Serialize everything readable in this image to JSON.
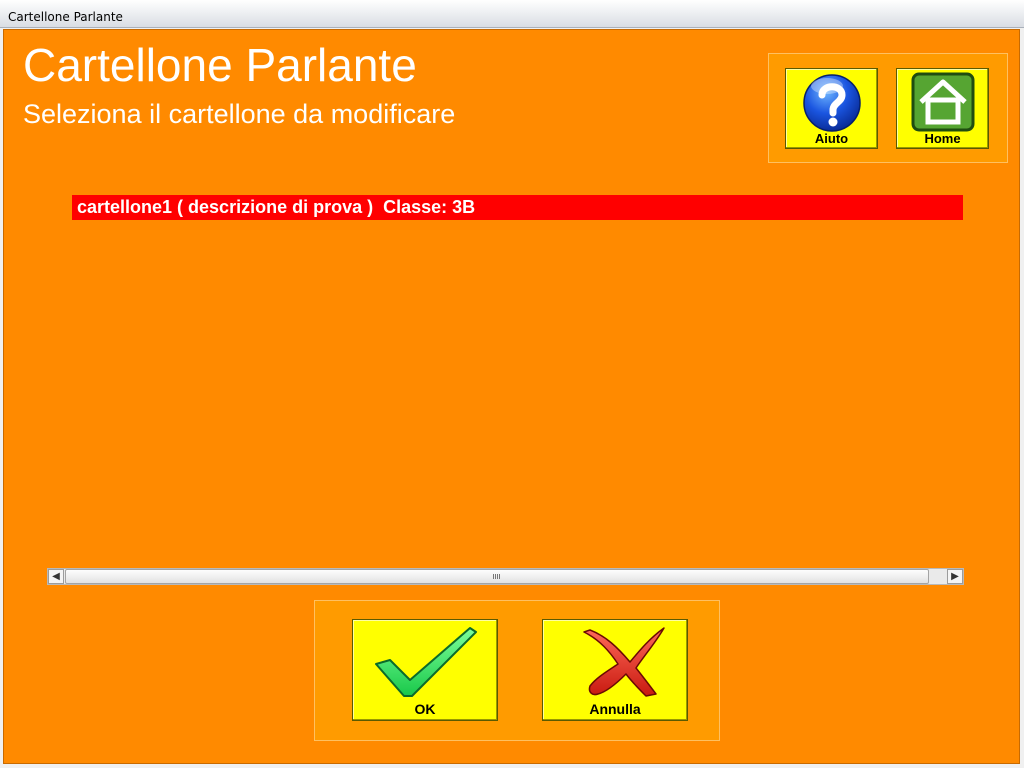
{
  "window": {
    "title": "Cartellone Parlante"
  },
  "header": {
    "title": "Cartellone Parlante",
    "subtitle": "Seleziona il cartellone da modificare"
  },
  "toolbar": {
    "help_label": "Aiuto",
    "home_label": "Home"
  },
  "list": {
    "items": [
      {
        "label": "cartellone1 ( descrizione di prova )  Classe: 3B",
        "selected": true
      }
    ]
  },
  "actions": {
    "ok_label": "OK",
    "cancel_label": "Annulla"
  },
  "colors": {
    "background": "#ff8a00",
    "button": "#ffff00",
    "selection": "#ff0000"
  },
  "icons": {
    "help": "question-mark-icon",
    "home": "home-icon",
    "ok": "checkmark-icon",
    "cancel": "cross-icon"
  }
}
